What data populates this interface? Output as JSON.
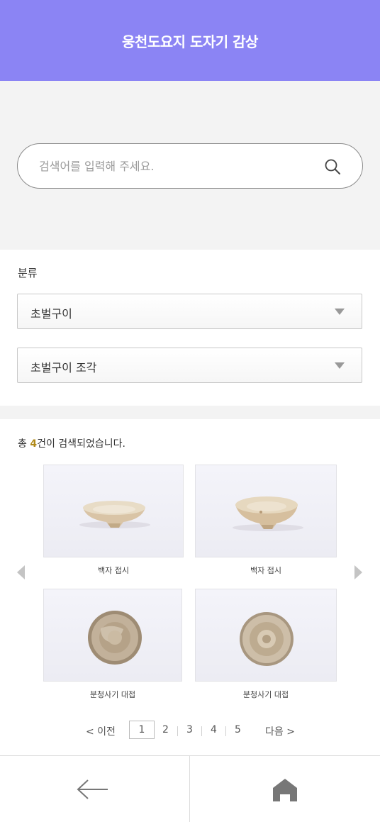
{
  "header": {
    "title": "웅천도요지 도자기 감상"
  },
  "search": {
    "placeholder": "검색어를 입력해 주세요.",
    "value": "",
    "button_icon": "search-icon"
  },
  "filter": {
    "label": "분류",
    "select_1": {
      "value": "초벌구이"
    },
    "select_2": {
      "value": "초벌구이 조각"
    }
  },
  "results": {
    "count_prefix": "총 ",
    "count_value": "4",
    "count_suffix": "건이 검색되었습니다.",
    "items": [
      {
        "caption": "백자 접시"
      },
      {
        "caption": "백자 접시"
      },
      {
        "caption": "분청사기 대접"
      },
      {
        "caption": "분청사기 대접"
      }
    ]
  },
  "pagination": {
    "prev_label": "<  이전",
    "next_label": "다음  >",
    "current": "1",
    "pages": [
      "2",
      "3",
      "4",
      "5"
    ]
  },
  "footer": {
    "back_icon": "arrow-left-icon",
    "home_icon": "home-icon"
  },
  "colors": {
    "header_bg": "#8b84f4",
    "count_highlight": "#b08a1a"
  }
}
